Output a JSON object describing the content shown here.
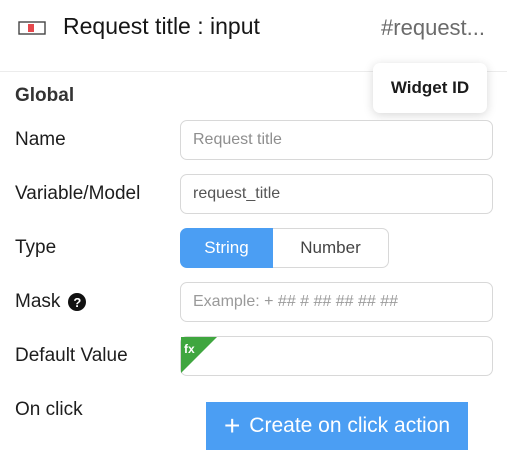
{
  "header": {
    "icon": "text-input-icon",
    "title": "Request title : input",
    "widget_id": "#request..."
  },
  "tooltip": {
    "text": "Widget ID"
  },
  "section": {
    "title": "Global"
  },
  "fields": {
    "name": {
      "label": "Name",
      "placeholder": "Request title"
    },
    "variable": {
      "label": "Variable/Model",
      "value": "request_title"
    },
    "type": {
      "label": "Type",
      "options": [
        "String",
        "Number"
      ],
      "selected": "String"
    },
    "mask": {
      "label": "Mask",
      "help_icon": "?",
      "placeholder": "Example: + ## # ## ## ## ##"
    },
    "default_value": {
      "label": "Default Value",
      "badge": "fx",
      "value": ""
    },
    "on_click": {
      "label": "On click",
      "button_label": "Create on click action",
      "button_icon": "+"
    }
  },
  "colors": {
    "accent": "#4b9ef3",
    "fx_badge": "#3fa63f"
  }
}
